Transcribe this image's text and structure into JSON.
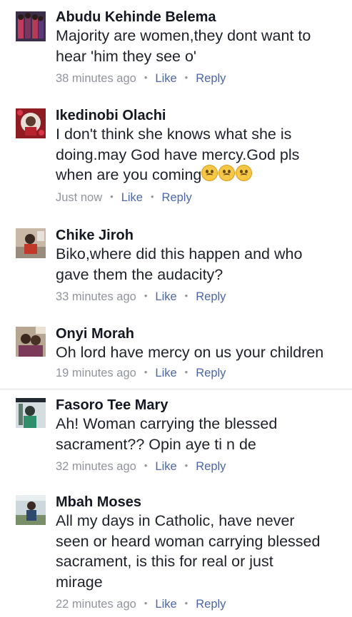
{
  "comments": [
    {
      "author": "Abudu Kehinde Belema",
      "lines": [
        "Majority are women,they dont want to",
        "hear 'him they see o'"
      ],
      "time": "38 minutes ago",
      "like": "Like",
      "reply": "Reply"
    },
    {
      "author": "Ikedinobi Olachi",
      "lines": [
        "I don't think she knows what she is",
        "doing.may God have mercy.God pls",
        "when are you coming"
      ],
      "time": "Just now",
      "like": "Like",
      "reply": "Reply",
      "emoji": "crying-face"
    },
    {
      "author": "Chike Jiroh",
      "lines": [
        "Biko,where did this happen and who",
        "gave them the audacity?"
      ],
      "time": "33 minutes ago",
      "like": "Like",
      "reply": "Reply"
    },
    {
      "author": "Onyi Morah",
      "lines": [
        "Oh lord have mercy on us your children"
      ],
      "time": "19 minutes ago",
      "like": "Like",
      "reply": "Reply"
    },
    {
      "author": "Fasoro Tee Mary",
      "lines": [
        "Ah! Woman carrying the blessed",
        "sacrament?? Opin aye ti n de"
      ],
      "time": "32 minutes ago",
      "like": "Like",
      "reply": "Reply"
    },
    {
      "author": "Mbah Moses",
      "lines": [
        "All my days in Catholic, have never",
        "seen or heard woman carrying blessed",
        "sacrament, is this for real or just",
        "mirage"
      ],
      "time": "22 minutes ago",
      "like": "Like",
      "reply": "Reply"
    }
  ],
  "separator": "•"
}
